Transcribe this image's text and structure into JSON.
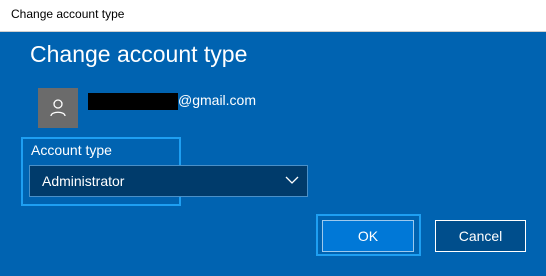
{
  "window": {
    "title": "Change account type"
  },
  "dialog": {
    "heading": "Change account type",
    "account": {
      "email_suffix": "@gmail.com",
      "avatar_icon": "user-icon"
    },
    "account_type": {
      "label": "Account type",
      "selected": "Administrator",
      "dropdown_icon": "chevron-down-icon"
    },
    "buttons": {
      "ok": "OK",
      "cancel": "Cancel"
    }
  },
  "colors": {
    "dialog_background": "#0063b1",
    "focus_highlight": "#1e9ff2",
    "select_background": "#003b6b",
    "ok_button": "#0078d7",
    "cancel_button": "#004e8c"
  }
}
